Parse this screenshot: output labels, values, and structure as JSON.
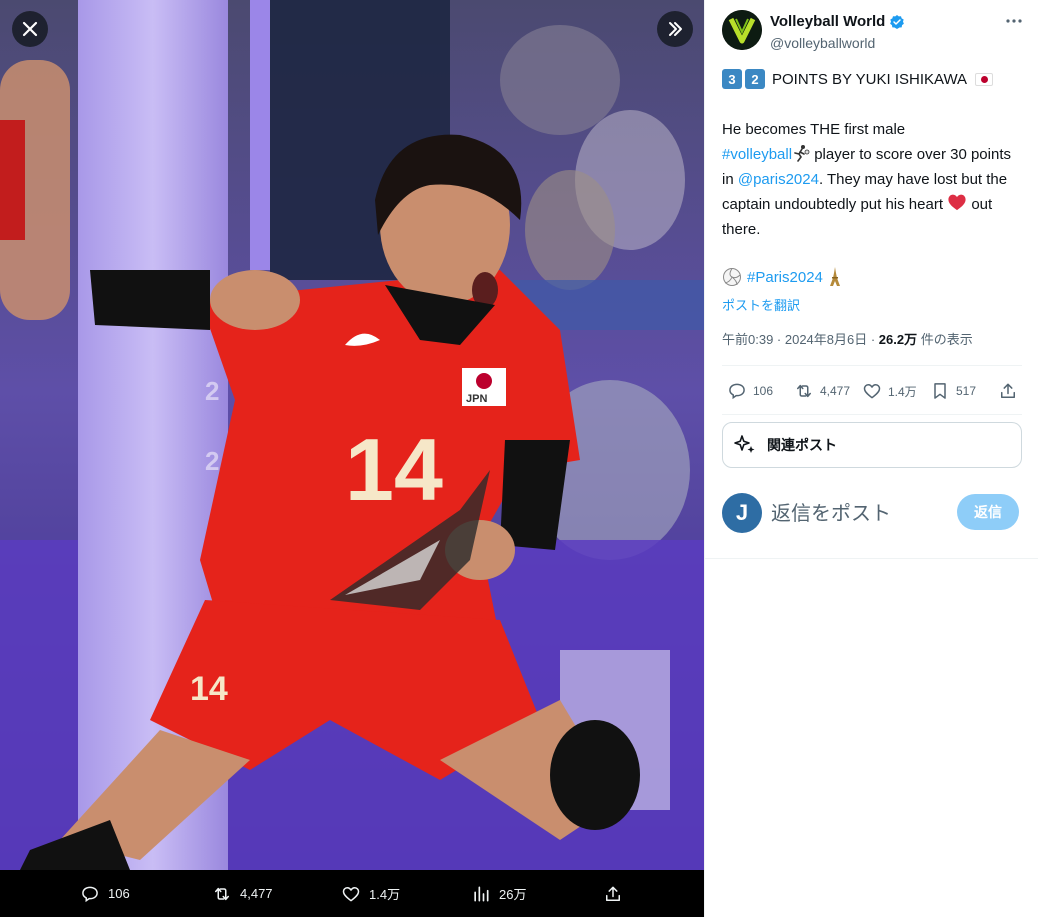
{
  "media": {
    "jersey_number": "14",
    "jersey_country": "JPN",
    "bar": {
      "replies": "106",
      "reposts": "4,477",
      "likes": "1.4万",
      "views": "26万"
    }
  },
  "author": {
    "name": "Volleyball World",
    "handle": "@volleyballworld",
    "avatar_letter": "V",
    "verified": true
  },
  "tweet": {
    "headline_digits": [
      "3",
      "2"
    ],
    "headline_text": "POINTS BY YUKI ISHIKAWA",
    "body_1": "He becomes THE first male ",
    "hashtag_volleyball": "#volleyball",
    "body_2": " player to score over 30 points in ",
    "mention": "@paris2024",
    "body_3": ". They may have lost but the captain undoubtedly put his heart ",
    "body_4": " out there.",
    "hashtag_paris": "#Paris2024",
    "translate": "ポストを翻訳",
    "meta_time": "午前0:39 · 2024年8月6日 · ",
    "meta_views": "26.2万",
    "meta_views_suffix": " 件の表示"
  },
  "actions": {
    "replies": "106",
    "reposts": "4,477",
    "likes": "1.4万",
    "bookmarks": "517"
  },
  "related": {
    "label": "関連ポスト"
  },
  "reply": {
    "avatar_letter": "J",
    "placeholder": "返信をポスト",
    "button": "返信"
  },
  "colors": {
    "accent": "#1d9bf0",
    "reply_button": "#8ecdf8",
    "jersey_red": "#e5231b",
    "court_purple": "#5a3fb0"
  }
}
